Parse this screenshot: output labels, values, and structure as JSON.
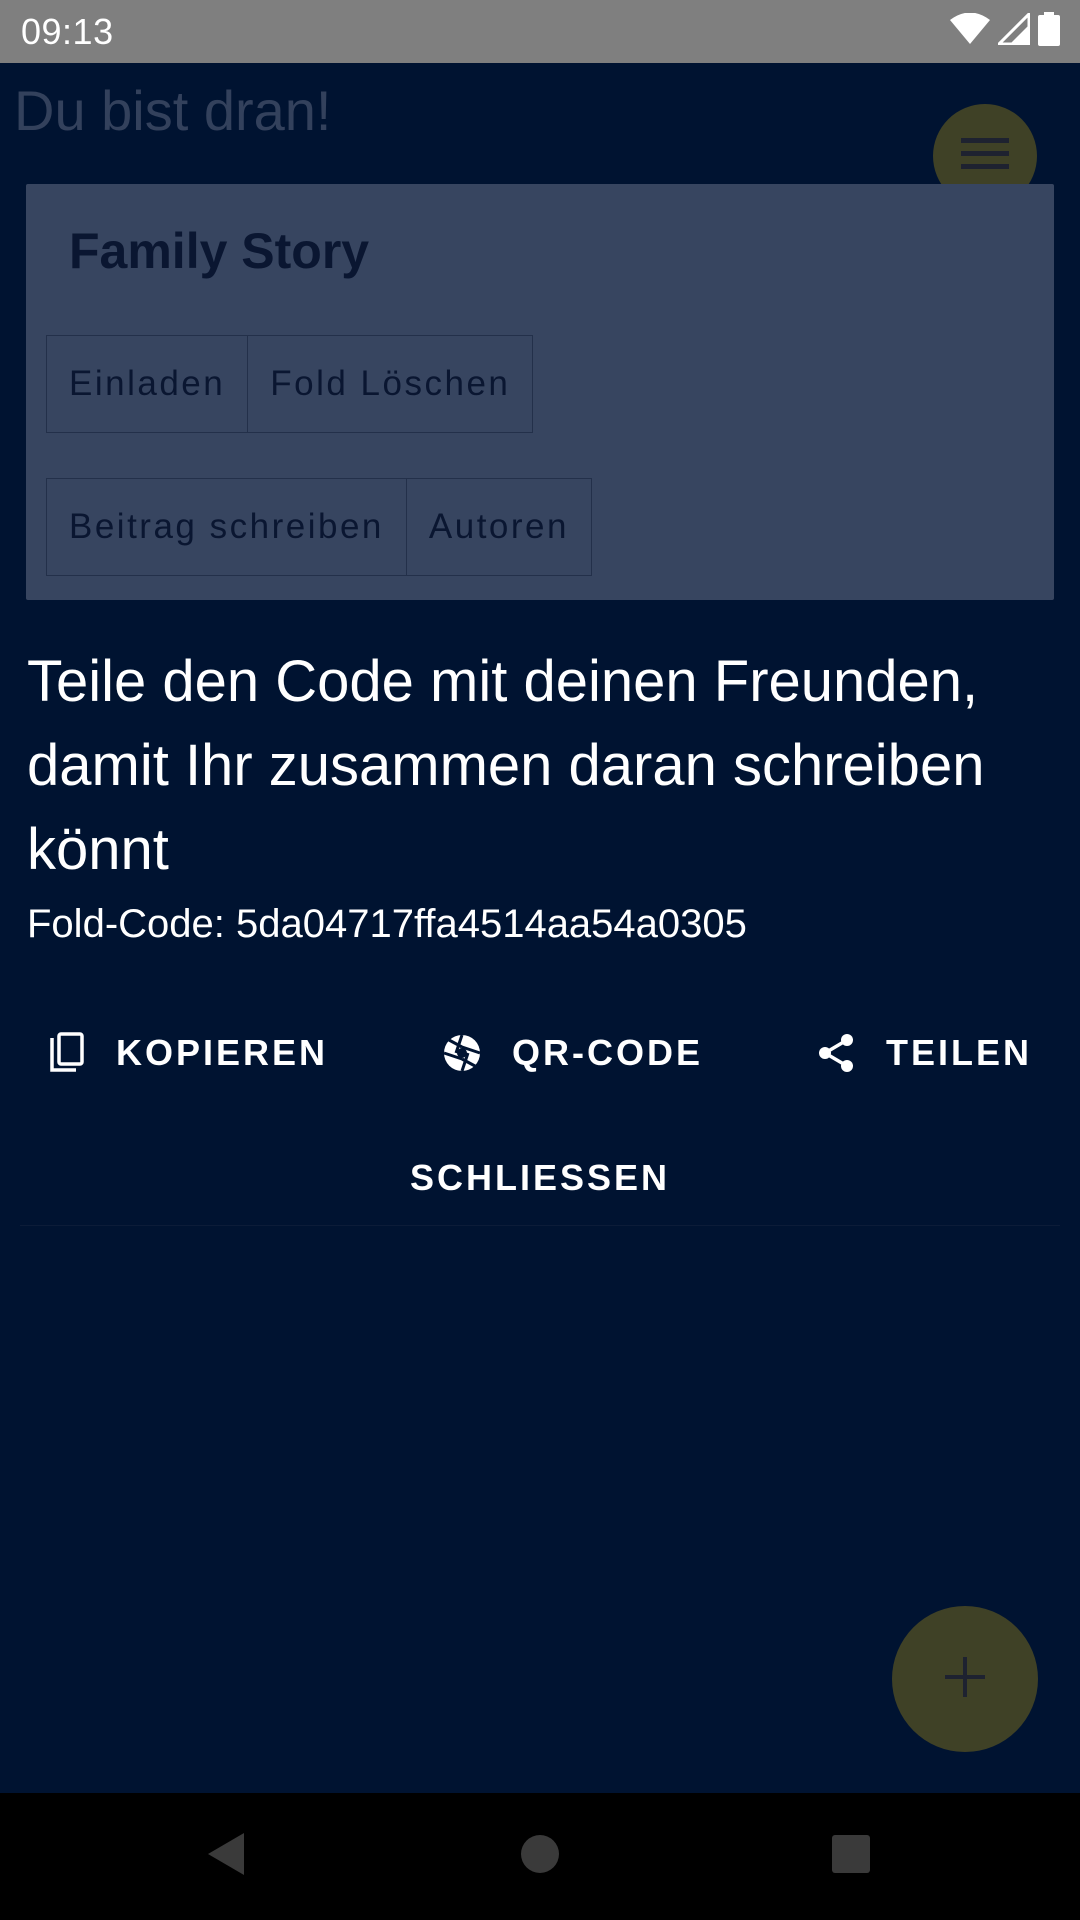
{
  "status_bar": {
    "time": "09:13",
    "icons": [
      "wifi-icon",
      "cell-signal-icon",
      "battery-icon"
    ]
  },
  "app": {
    "title": "Du bist dran!",
    "card": {
      "title": "Family Story",
      "buttons_row1": [
        "Einladen",
        "Fold Löschen"
      ],
      "buttons_row2": [
        "Beitrag schreiben",
        "Autoren"
      ]
    }
  },
  "sheet": {
    "heading": "Teile den Code mit deinen Freunden, damit Ihr zusammen daran schreiben könnt",
    "fold_code": "Fold-Code: 5da04717ffa4514aa54a0305",
    "actions": {
      "copy": "KOPIEREN",
      "qr": "QR-CODE",
      "share": "TEILEN"
    },
    "close": "SCHLIESSEN"
  },
  "colors": {
    "background": "#001331",
    "card": "#374560",
    "fab": "#3f4126",
    "status_bar": "#7f7f7f",
    "text": "#ffffff"
  }
}
